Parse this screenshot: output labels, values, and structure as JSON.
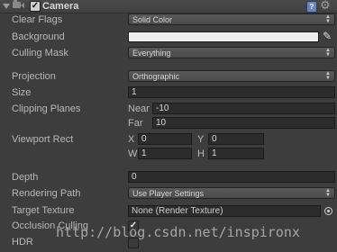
{
  "header": {
    "title": "Camera",
    "enabled": "✓"
  },
  "clear_flags": {
    "label": "Clear Flags",
    "value": "Solid Color"
  },
  "background": {
    "label": "Background",
    "color": "#eeeeee"
  },
  "culling_mask": {
    "label": "Culling Mask",
    "value": "Everything"
  },
  "projection": {
    "label": "Projection",
    "value": "Orthographic"
  },
  "size": {
    "label": "Size",
    "value": "1"
  },
  "clipping_planes": {
    "label": "Clipping Planes",
    "near_label": "Near",
    "near_value": "-10",
    "far_label": "Far",
    "far_value": "10"
  },
  "viewport_rect": {
    "label": "Viewport Rect",
    "x_label": "X",
    "x_value": "0",
    "y_label": "Y",
    "y_value": "0",
    "w_label": "W",
    "w_value": "1",
    "h_label": "H",
    "h_value": "1"
  },
  "depth": {
    "label": "Depth",
    "value": "0"
  },
  "rendering_path": {
    "label": "Rendering Path",
    "value": "Use Player Settings"
  },
  "target_texture": {
    "label": "Target Texture",
    "value": "None (Render Texture)"
  },
  "occlusion_culling": {
    "label": "Occlusion Culling",
    "checked": "✓"
  },
  "hdr": {
    "label": "HDR",
    "checked": ""
  },
  "watermark": "http://blog.csdn.net/inspironx"
}
